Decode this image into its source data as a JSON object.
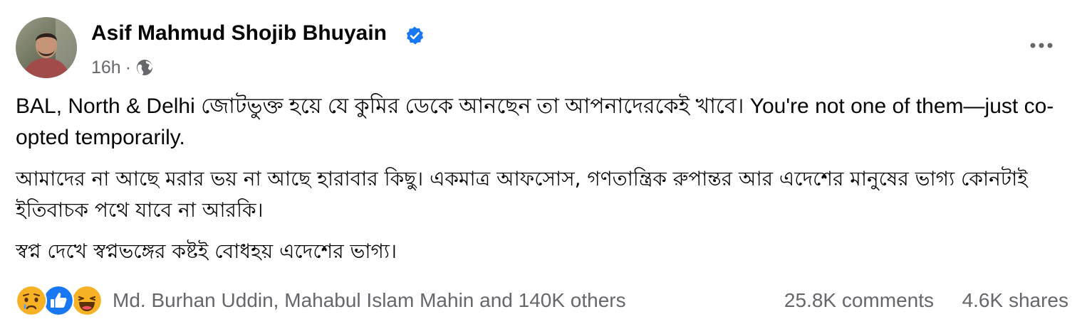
{
  "post": {
    "author": {
      "name": "Asif Mahmud Shojib Bhuyain",
      "verified": true,
      "verified_icon": "verified-badge-icon",
      "avatar_icon": "profile-photo"
    },
    "meta": {
      "time": "16h",
      "separator": "·",
      "audience_icon": "globe-icon"
    },
    "more_icon": "more-horizontal-icon",
    "paragraphs": [
      "BAL, North & Delhi জোটভুক্ত হয়ে যে কুমির ডেকে আনছেন তা আপনাদেরকেই খাবে। You're not one of them—just co-opted temporarily.",
      "আমাদের না আছে মরার ভয় না আছে হারাবার কিছু। একমাত্র আফসোস, গণতান্ত্রিক রুপান্তর আর এদেশের মানুষের ভাগ্য কোনটাই ইতিবাচক পথে যাবে না আরকি।",
      "স্বপ্ন দেখে স্বপ্নভঙ্গের কষ্টই বোধহয় এদেশের ভাগ্য।"
    ],
    "reactions": {
      "icons": [
        "sad-reaction-icon",
        "like-reaction-icon",
        "haha-reaction-icon"
      ],
      "summary": "Md. Burhan Uddin, Mahabul Islam Mahin and 140K others",
      "comments": "25.8K comments",
      "shares": "4.6K shares"
    },
    "colors": {
      "text": "#050505",
      "secondary_text": "#65676b",
      "verified_blue": "#1877f2",
      "like_blue": "#1877f2",
      "emoji_yellow": "#f7b125"
    }
  }
}
